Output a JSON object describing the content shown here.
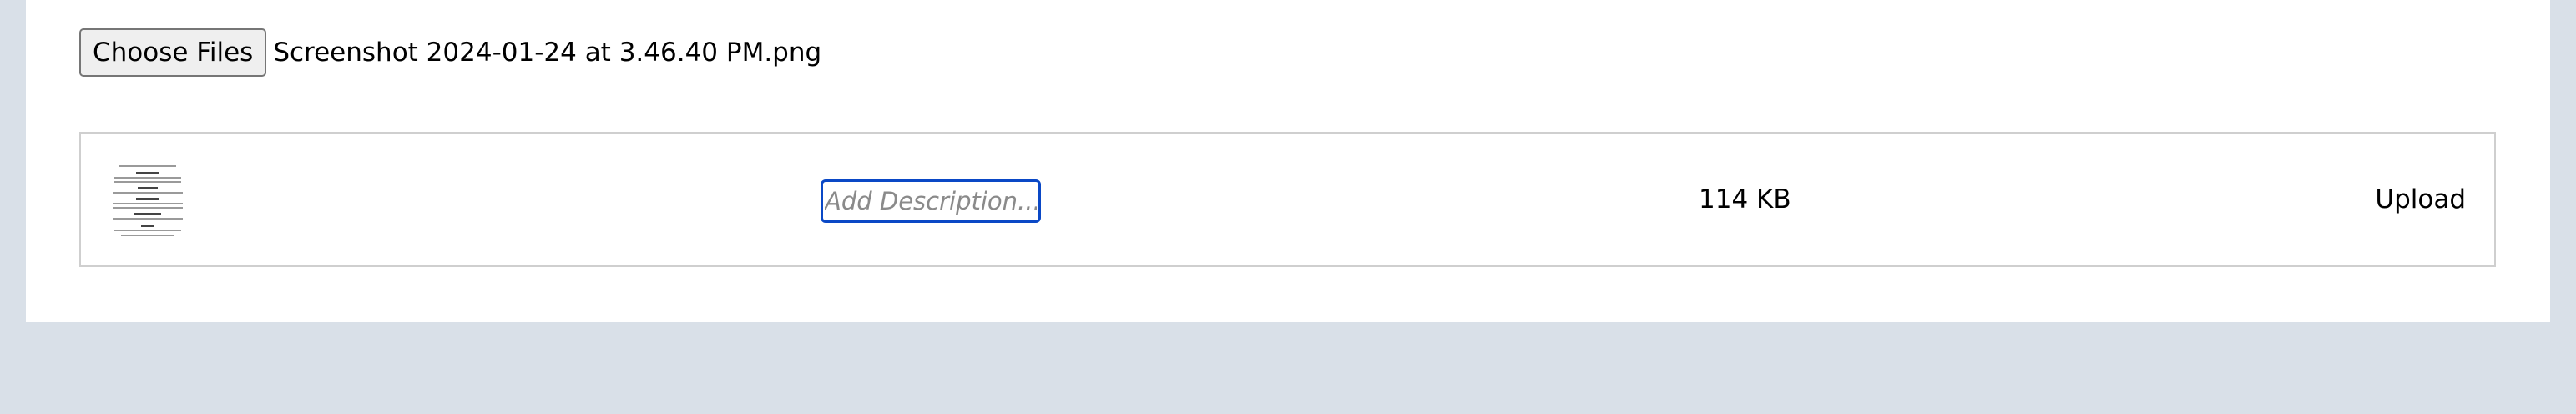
{
  "file_picker": {
    "button_label": "Choose Files",
    "selected_file": "Screenshot 2024-01-24 at 3.46.40 PM.png"
  },
  "upload_row": {
    "thumbnail": "document-preview-thumbnail",
    "description_placeholder": "Add Description...",
    "description_value": "",
    "file_size": "114 KB",
    "upload_label": "Upload"
  },
  "colors": {
    "page_background": "#d9e0e8",
    "panel_background": "#ffffff",
    "input_focus_border": "#0a48c6"
  }
}
